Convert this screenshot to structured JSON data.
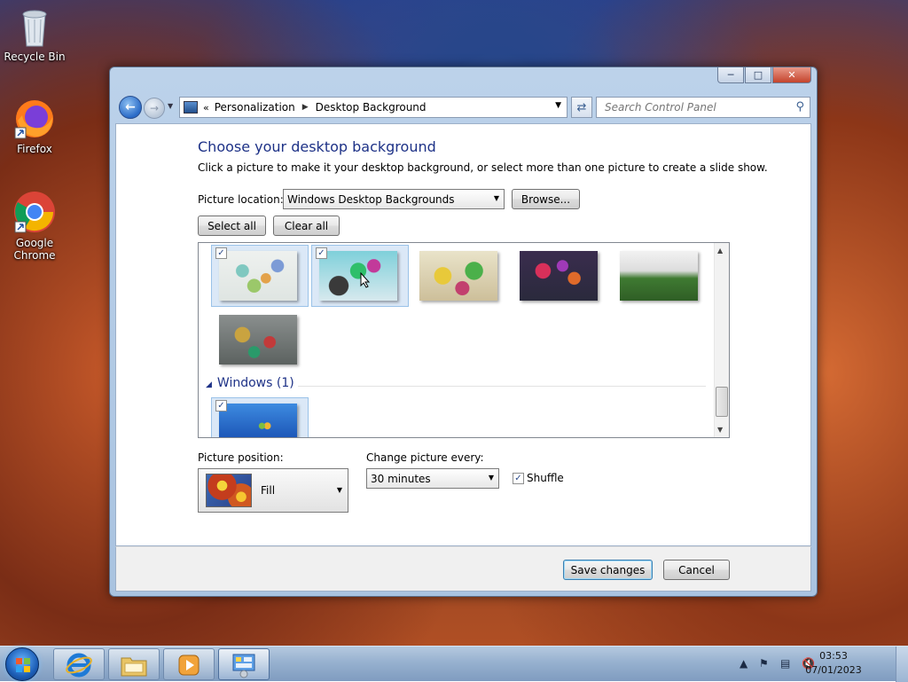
{
  "desktop": {
    "icons": [
      {
        "label": "Recycle Bin"
      },
      {
        "label": "Firefox"
      },
      {
        "label": "Google Chrome"
      }
    ]
  },
  "window": {
    "breadcrumb": [
      "Personalization",
      "Desktop Background"
    ],
    "search_placeholder": "Search Control Panel",
    "heading": "Choose your desktop background",
    "subtext": "Click a picture to make it your desktop background, or select more than one picture to create a slide show.",
    "picture_location_label": "Picture location:",
    "picture_location_value": "Windows Desktop Backgrounds",
    "browse_label": "Browse...",
    "select_all_label": "Select all",
    "clear_all_label": "Clear all",
    "group_windows_label": "Windows (1)",
    "picture_position_label": "Picture position:",
    "picture_position_value": "Fill",
    "change_every_label": "Change picture every:",
    "change_every_value": "30 minutes",
    "shuffle_label": "Shuffle",
    "save_label": "Save changes",
    "cancel_label": "Cancel"
  },
  "taskbar": {
    "clock_time": "03:53",
    "clock_date": "07/01/2023"
  }
}
